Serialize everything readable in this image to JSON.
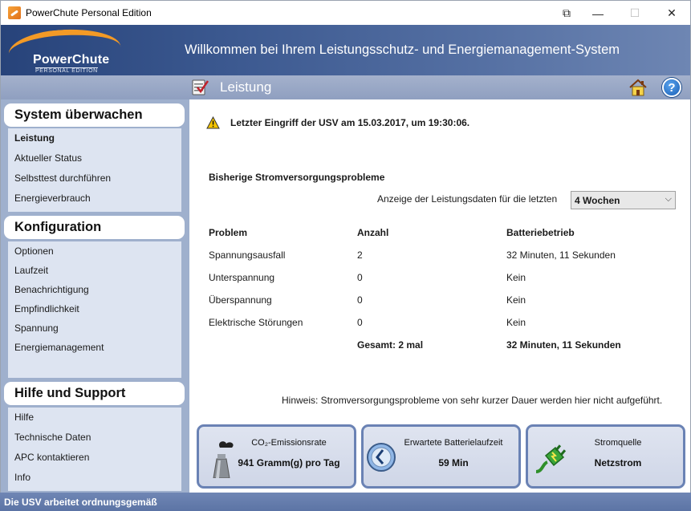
{
  "window": {
    "title": "PowerChute Personal Edition",
    "controls": {
      "snap": "⧉",
      "minimize": "—",
      "maximize": "☐",
      "close": "✕"
    }
  },
  "banner": {
    "logo_name": "PowerChute",
    "logo_sub": "PERSONAL EDITION",
    "title": "Willkommen bei Ihrem Leistungsschutz- und Energiemanagement-System"
  },
  "section": {
    "title": "Leistung",
    "icons": {
      "section": "checklist-icon",
      "home": "home-icon",
      "help": "help-icon"
    },
    "help_glyph": "?"
  },
  "sidebar": {
    "groups": [
      {
        "heading": "System überwachen",
        "items": [
          {
            "label": "Leistung",
            "active": true
          },
          {
            "label": "Aktueller Status"
          },
          {
            "label": "Selbsttest durchführen"
          },
          {
            "label": "Energieverbrauch"
          }
        ]
      },
      {
        "heading": "Konfiguration",
        "items": [
          {
            "label": "Optionen"
          },
          {
            "label": "Laufzeit"
          },
          {
            "label": "Benachrichtigung"
          },
          {
            "label": "Empfindlichkeit"
          },
          {
            "label": "Spannung"
          },
          {
            "label": "Energiemanagement"
          }
        ]
      },
      {
        "heading": "Hilfe und Support",
        "items": [
          {
            "label": "Hilfe"
          },
          {
            "label": "Technische Daten"
          },
          {
            "label": "APC kontaktieren"
          },
          {
            "label": "Info"
          }
        ]
      }
    ]
  },
  "main": {
    "last_event": "Letzter Eingriff der USV am 15.03.2017, um 19:30:06.",
    "history_title": "Bisherige Stromversorgungsprobleme",
    "range_label": "Anzeige der Leistungsdaten für die letzten",
    "range_value": "4 Wochen",
    "table": {
      "headers": [
        "Problem",
        "Anzahl",
        "Batteriebetrieb"
      ],
      "rows": [
        [
          "Spannungsausfall",
          "2",
          "32 Minuten, 11 Sekunden"
        ],
        [
          "Unterspannung",
          "0",
          "Kein"
        ],
        [
          "Überspannung",
          "0",
          "Kein"
        ],
        [
          "Elektrische Störungen",
          "0",
          "Kein"
        ]
      ],
      "total": {
        "count": "Gesamt:  2 mal",
        "battery": "32 Minuten, 11 Sekunden"
      }
    },
    "hint": "Hinweis: Stromversorgungsprobleme von sehr kurzer Dauer werden hier nicht aufgeführt.",
    "tiles": [
      {
        "title": "CO₂-Emissionsrate",
        "value": "941 Gramm(g) pro Tag",
        "icon": "factory-icon"
      },
      {
        "title": "Erwartete Batterielaufzeit",
        "value": "59 Min",
        "icon": "clock-icon"
      },
      {
        "title": "Stromquelle",
        "value": "Netzstrom",
        "icon": "power-plug-icon"
      }
    ]
  },
  "statusbar": {
    "text": "Die USV arbeitet ordnungsgemäß"
  },
  "colors": {
    "banner_dark": "#27437a",
    "sidebar_bg": "#9fb0cd",
    "panel_bg": "#dde4f1",
    "tile_border": "#6a82b4",
    "logo_accent": "#f39a26",
    "warning": "#f5c400"
  }
}
